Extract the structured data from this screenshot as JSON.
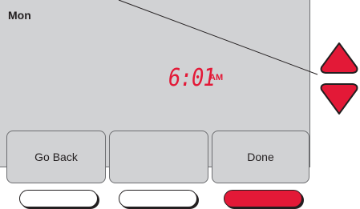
{
  "screen": {
    "day": "Mon",
    "time_digits": "6:01",
    "time_period": "AM"
  },
  "soft_buttons": [
    {
      "label": "Go Back"
    },
    {
      "label": ""
    },
    {
      "label": "Done"
    }
  ],
  "colors": {
    "screen_bg": "#d1d2d4",
    "accent_red": "#e31937",
    "outline": "#231f20"
  },
  "icons": {
    "up": "up-arrow-icon",
    "down": "down-arrow-icon"
  }
}
